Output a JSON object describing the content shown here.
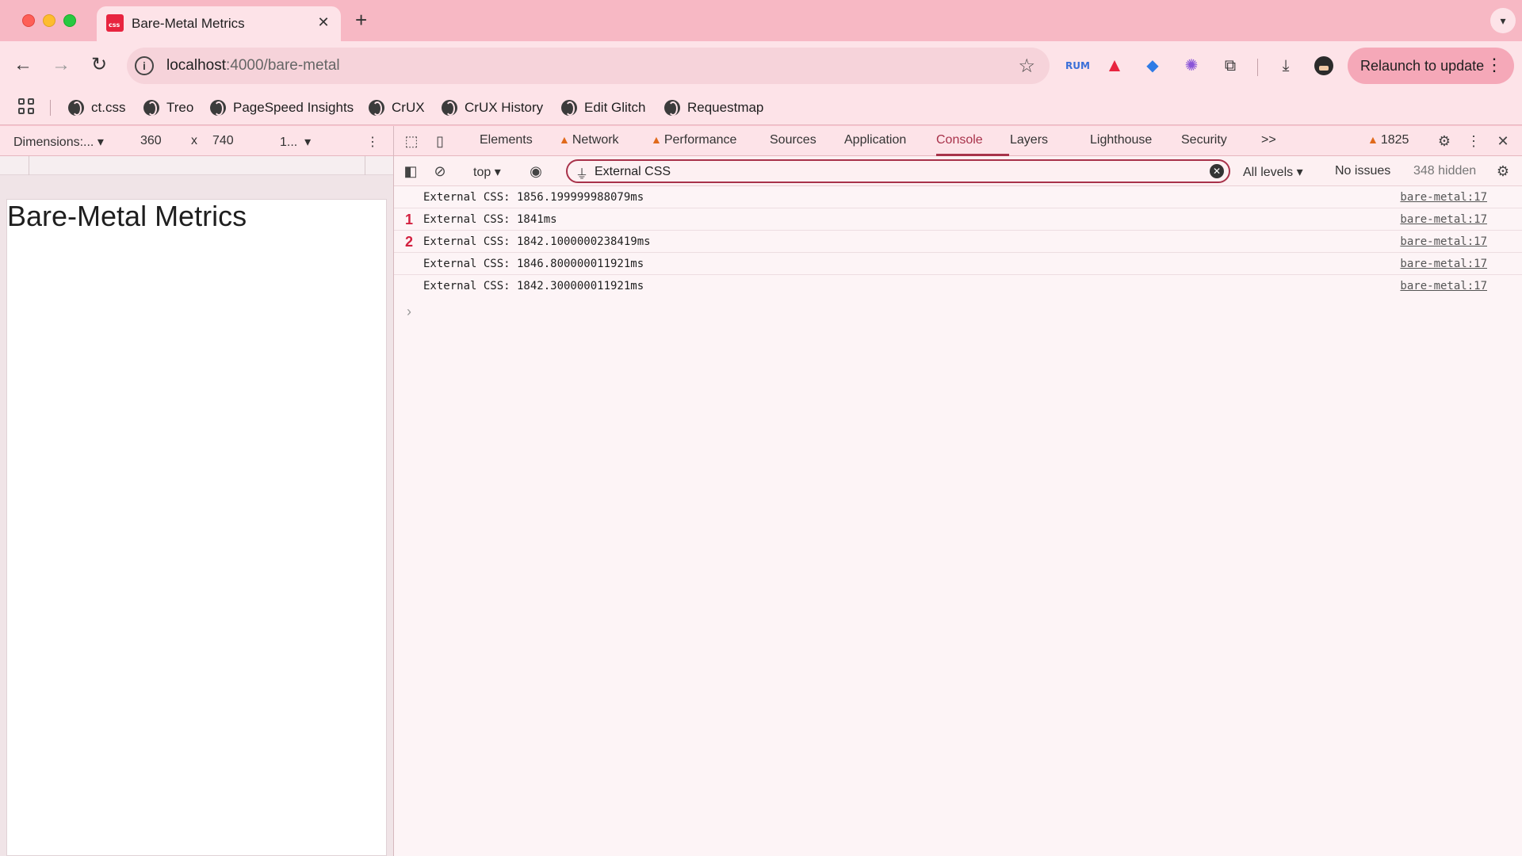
{
  "browser": {
    "tab_title": "Bare-Metal Metrics",
    "url_host": "localhost",
    "url_path": ":4000/bare-metal",
    "relaunch_label": "Relaunch to update",
    "extension_rum_label": "RUM"
  },
  "bookmarks": [
    {
      "label": "ct.css"
    },
    {
      "label": "Treo"
    },
    {
      "label": "PageSpeed Insights"
    },
    {
      "label": "CrUX"
    },
    {
      "label": "CrUX History"
    },
    {
      "label": "Edit Glitch"
    },
    {
      "label": "Requestmap"
    }
  ],
  "device_toolbar": {
    "dimensions_label": "Dimensions:...",
    "width": "360",
    "times": "x",
    "height": "740",
    "zoom": "1..."
  },
  "page": {
    "heading": "Bare-Metal Metrics"
  },
  "devtools": {
    "tabs": {
      "elements": "Elements",
      "network": "Network",
      "performance": "Performance",
      "sources": "Sources",
      "application": "Application",
      "console": "Console",
      "layers": "Layers",
      "lighthouse": "Lighthouse",
      "security": "Security",
      "more": ">>"
    },
    "active_tab": "Console",
    "warning_count": "1825",
    "console_bar": {
      "context": "top",
      "filter_value": "External CSS",
      "levels": "All levels",
      "issues": "No issues",
      "hidden": "348 hidden"
    },
    "logs": [
      {
        "count": "",
        "message": "External CSS: 1856.199999988079ms",
        "source": "bare-metal:17"
      },
      {
        "count": "1",
        "message": "External CSS: 1841ms",
        "source": "bare-metal:17"
      },
      {
        "count": "2",
        "message": "External CSS: 1842.1000000238419ms",
        "source": "bare-metal:17"
      },
      {
        "count": "",
        "message": "External CSS: 1846.800000011921ms",
        "source": "bare-metal:17"
      },
      {
        "count": "",
        "message": "External CSS: 1842.300000011921ms",
        "source": "bare-metal:17"
      }
    ]
  },
  "colors": {
    "accent": "#a8324a",
    "chrome_bg": "#fde3e8",
    "tabstrip_bg": "#f7b8c4",
    "warning": "#e06a1b",
    "repeat_count": "#d3203f"
  }
}
